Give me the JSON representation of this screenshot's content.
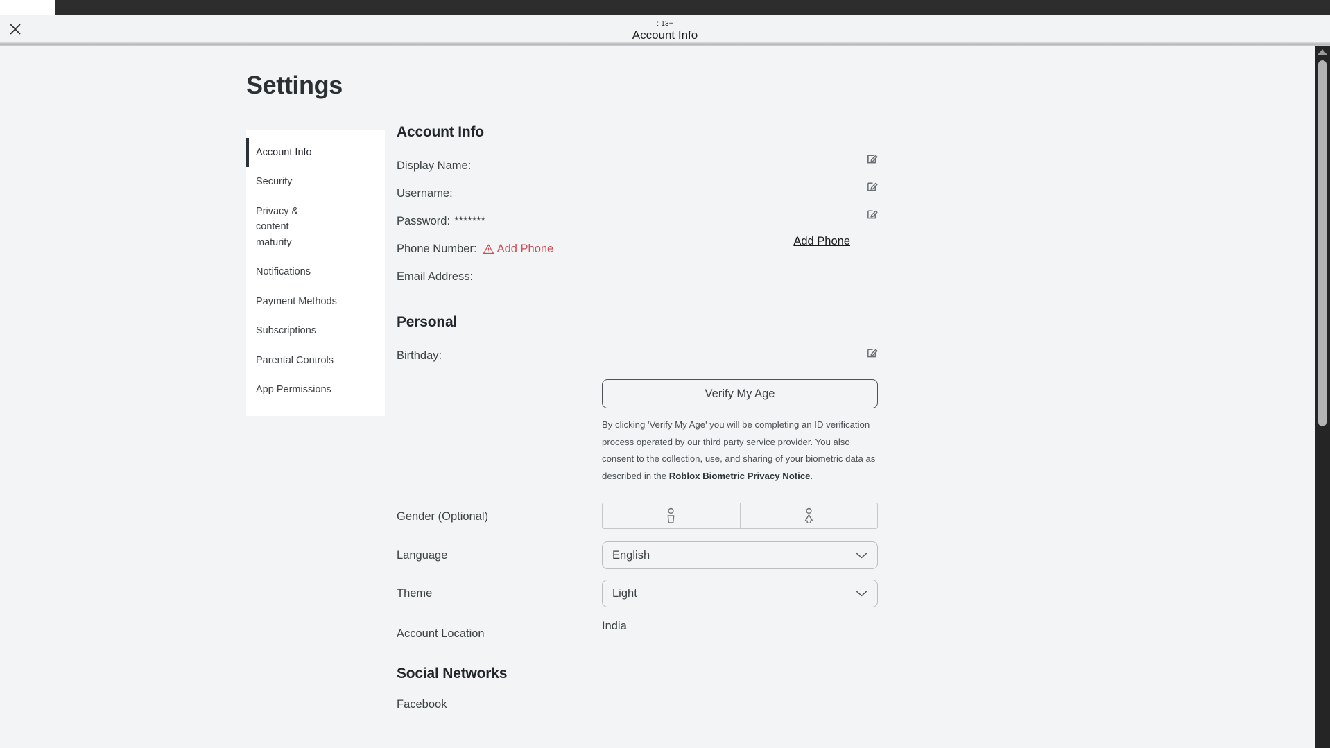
{
  "window": {
    "close_label": "close",
    "age_badge": ": 13+",
    "title": "Account Info"
  },
  "page_title": "Settings",
  "sidebar": {
    "items": [
      {
        "label": "Account Info",
        "active": true
      },
      {
        "label": "Security",
        "active": false
      },
      {
        "label": "Privacy & content maturity",
        "active": false
      },
      {
        "label": "Notifications",
        "active": false
      },
      {
        "label": "Payment Methods",
        "active": false
      },
      {
        "label": "Subscriptions",
        "active": false
      },
      {
        "label": "Parental Controls",
        "active": false
      },
      {
        "label": "App Permissions",
        "active": false
      }
    ]
  },
  "account_info": {
    "heading": "Account Info",
    "display_name_label": "Display Name:",
    "display_name_value": "",
    "username_label": "Username:",
    "username_value": "",
    "password_label": "Password:",
    "password_value": "*******",
    "phone_label": "Phone Number:",
    "phone_warning": "Add Phone",
    "phone_action": "Add Phone",
    "email_label": "Email Address:",
    "email_value": ""
  },
  "personal": {
    "heading": "Personal",
    "birthday_label": "Birthday:",
    "birthday_value": "",
    "verify_button": "Verify My Age",
    "verify_note_1": "By clicking 'Verify My Age' you will be completing an ID verification process operated by our third party service provider. You also consent to the collection, use, and sharing of your biometric data as described in the ",
    "verify_note_bold": "Roblox Biometric Privacy Notice",
    "verify_note_2": ".",
    "gender_label": "Gender (Optional)",
    "gender_option_male": "male",
    "gender_option_female": "female",
    "language_label": "Language",
    "language_value": "English",
    "theme_label": "Theme",
    "theme_value": "Light",
    "account_location_label": "Account Location",
    "account_location_value": "India"
  },
  "social": {
    "heading": "Social Networks",
    "facebook_label": "Facebook"
  },
  "colors": {
    "accent_warning": "#d14a54",
    "page_bg": "#f2f4f5",
    "sidebar_bg": "#ffffff",
    "active_bar": "#2b3034"
  }
}
